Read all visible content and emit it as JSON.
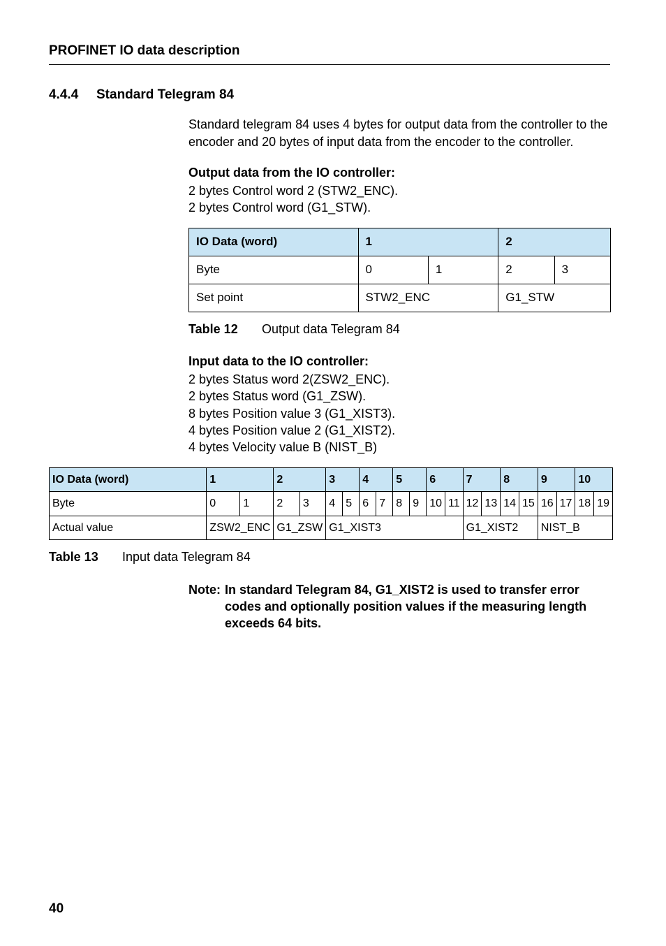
{
  "header": "PROFINET IO data description",
  "section": {
    "number": "4.4.4",
    "title": "Standard Telegram 84"
  },
  "intro": "Standard telegram 84 uses 4 bytes for output data from the controller to the encoder and 20 bytes of input data from the encoder to the controller.",
  "output_block": {
    "heading": "Output data from the IO controller:",
    "line1": "2 bytes Control word 2 (STW2_ENC).",
    "line2": "2 bytes Control word (G1_STW)."
  },
  "table12": {
    "h1": "IO Data (word)",
    "h2": "1",
    "h3": "2",
    "r1c1": "Byte",
    "r1c2": "0",
    "r1c3": "1",
    "r1c4": "2",
    "r1c5": "3",
    "r2c1": "Set point",
    "r2c2": "STW2_ENC",
    "r2c3": "G1_STW",
    "caption_label": "Table 12",
    "caption_text": "Output data Telegram 84"
  },
  "input_block": {
    "heading": "Input data to the IO controller:",
    "line1": "2 bytes Status word 2(ZSW2_ENC).",
    "line2": "2 bytes Status word (G1_ZSW).",
    "line3": "8 bytes Position value 3 (G1_XIST3).",
    "line4": "4 bytes Position value 2 (G1_XIST2).",
    "line5": "4 bytes Velocity value B (NIST_B)"
  },
  "table13": {
    "h_io": "IO Data (word)",
    "h1": "1",
    "h2": "2",
    "h3": "3",
    "h4": "4",
    "h5": "5",
    "h6": "6",
    "h7": "7",
    "h8": "8",
    "h9": "9",
    "h10": "10",
    "byte_label": "Byte",
    "b0": "0",
    "b1": "1",
    "b2": "2",
    "b3": "3",
    "b4": "4",
    "b5": "5",
    "b6": "6",
    "b7": "7",
    "b8": "8",
    "b9": "9",
    "b10": "10",
    "b11": "11",
    "b12": "12",
    "b13": "13",
    "b14": "14",
    "b15": "15",
    "b16": "16",
    "b17": "17",
    "b18": "18",
    "b19": "19",
    "actual_label": "Actual value",
    "av1": "ZSW2_ENC",
    "av2": "G1_ZSW",
    "av3": "G1_XIST3",
    "av4": "G1_XIST2",
    "av5": "NIST_B",
    "caption_label": "Table 13",
    "caption_text": "Input data Telegram 84"
  },
  "note": {
    "label": "Note:",
    "text": "In standard Telegram 84, G1_XIST2 is used to transfer error codes and optionally position values if the measuring length exceeds 64 bits."
  },
  "page_number": "40"
}
